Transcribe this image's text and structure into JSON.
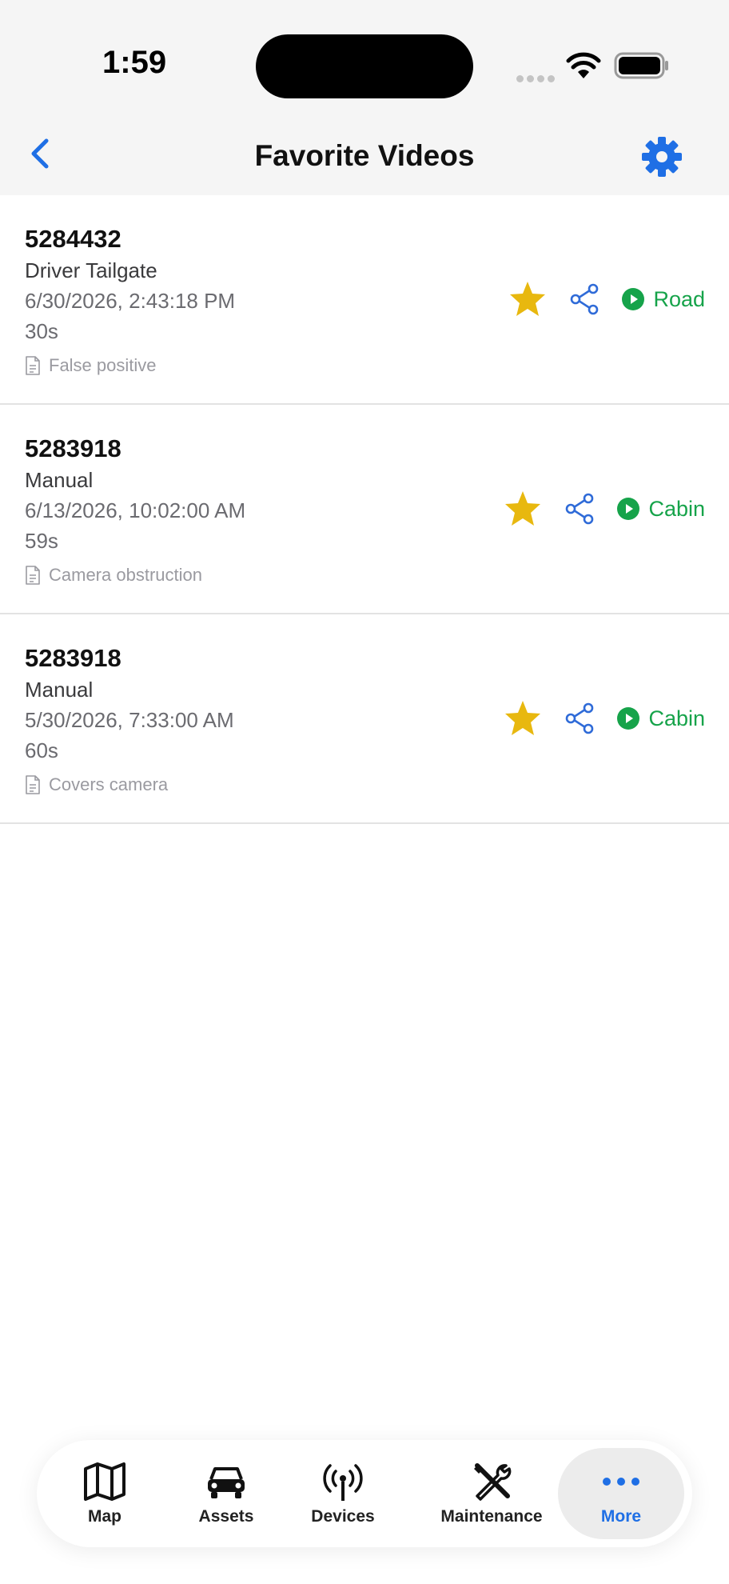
{
  "status_bar": {
    "time": "1:59"
  },
  "nav": {
    "title": "Favorite Videos"
  },
  "videos": [
    {
      "id": "5284432",
      "type": "Driver Tailgate",
      "date": "6/30/2026, 2:43:18 PM",
      "duration": "30s",
      "note": "False positive",
      "camera": "Road"
    },
    {
      "id": "5283918",
      "type": "Manual",
      "date": "6/13/2026, 10:02:00 AM",
      "duration": "59s",
      "note": "Camera obstruction",
      "camera": "Cabin"
    },
    {
      "id": "5283918",
      "type": "Manual",
      "date": "5/30/2026, 7:33:00 AM",
      "duration": "60s",
      "note": "Covers camera",
      "camera": "Cabin"
    }
  ],
  "tabs": [
    {
      "label": "Map",
      "icon": "map-icon"
    },
    {
      "label": "Assets",
      "icon": "car-icon"
    },
    {
      "label": "Devices",
      "icon": "antenna-icon"
    },
    {
      "label": "Maintenance",
      "icon": "tools-icon"
    },
    {
      "label": "More",
      "icon": "more-dots-icon",
      "active": true
    }
  ],
  "colors": {
    "accent": "#1f6fe5",
    "star": "#e8b80f",
    "camera": "#16a34a",
    "share": "#2f6bd8"
  }
}
